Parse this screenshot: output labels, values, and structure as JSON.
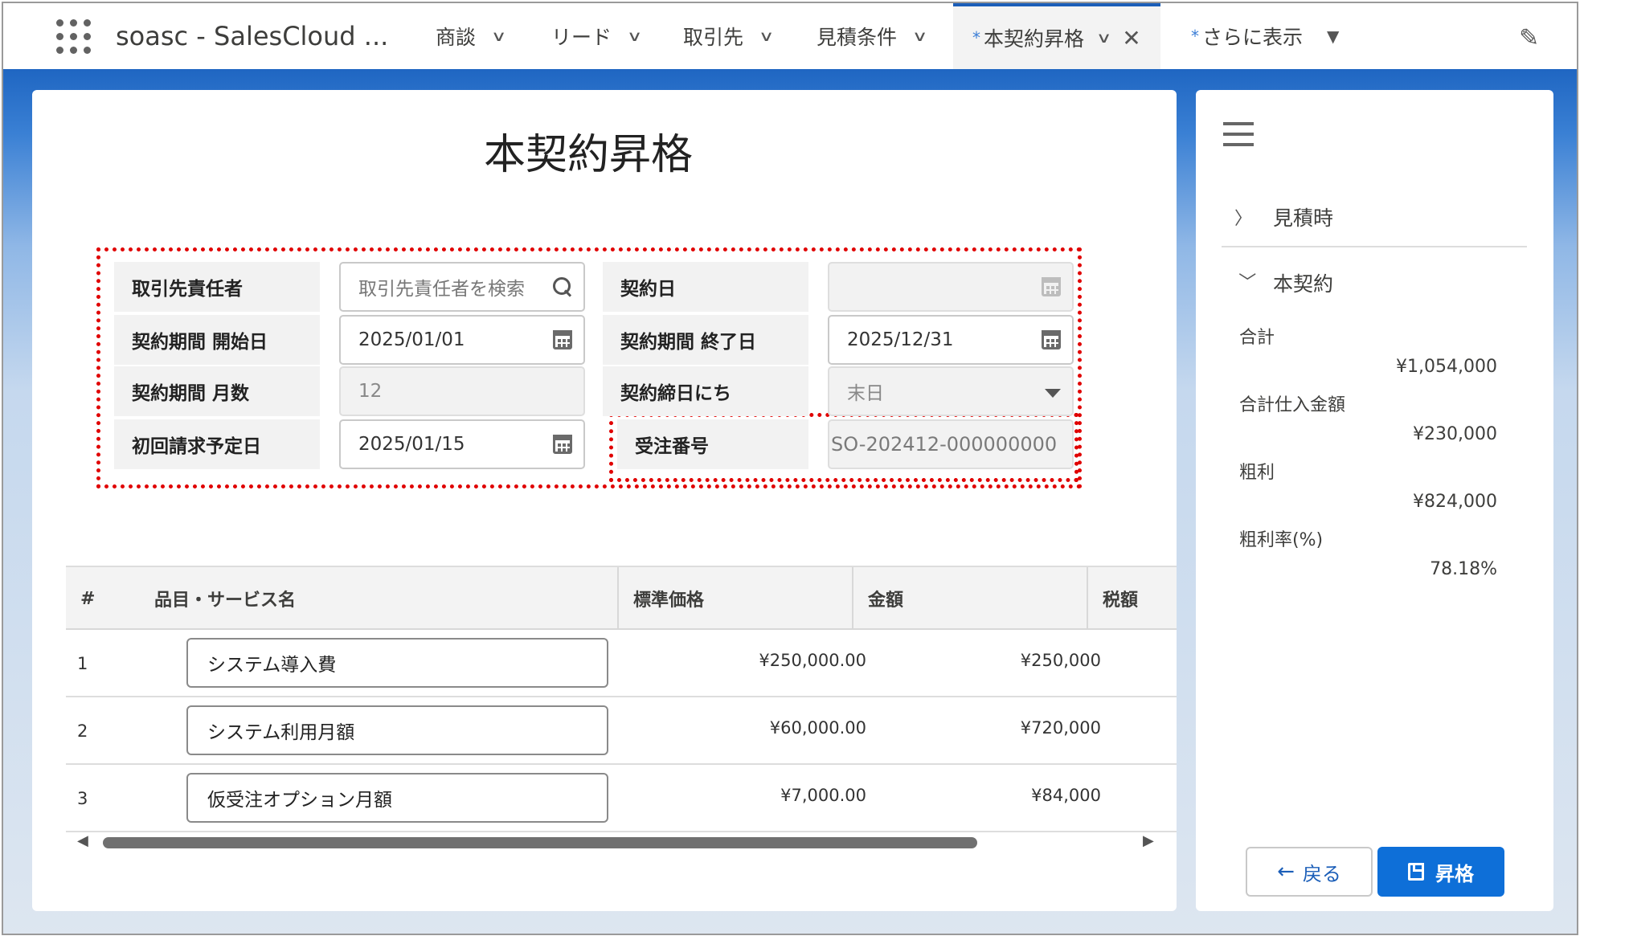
{
  "nav": {
    "app_name": "soasc - SalesCloud ...",
    "tabs": [
      {
        "label": "商談"
      },
      {
        "label": "リード"
      },
      {
        "label": "取引先"
      },
      {
        "label": "見積条件"
      },
      {
        "label": "本契約昇格",
        "modified_mark": "*",
        "active": true
      },
      {
        "label": "さらに表示",
        "modified_mark": "*"
      }
    ]
  },
  "page": {
    "title": "本契約昇格"
  },
  "form": {
    "contact_label": "取引先責任者",
    "contact_placeholder": "取引先責任者を検索",
    "contract_date_label": "契約日",
    "contract_date_value": "",
    "start_label": "契約期間 開始日",
    "start_value": "2025/01/01",
    "end_label": "契約期間 終了日",
    "end_value": "2025/12/31",
    "months_label": "契約期間 月数",
    "months_value": "12",
    "closing_label": "契約締日にち",
    "closing_value": "末日",
    "first_bill_label": "初回請求予定日",
    "first_bill_value": "2025/01/15",
    "order_no_label": "受注番号",
    "order_no_value": "SO-202412-000000000"
  },
  "table": {
    "headers": [
      "#",
      "品目・サービス名",
      "標準価格",
      "金額",
      "税額"
    ],
    "rows": [
      {
        "num": "1",
        "name": "システム導入費",
        "std_price": "¥250,000.00",
        "amount": "¥250,000"
      },
      {
        "num": "2",
        "name": "システム利用月額",
        "std_price": "¥60,000.00",
        "amount": "¥720,000"
      },
      {
        "num": "3",
        "name": "仮受注オプション月額",
        "std_price": "¥7,000.00",
        "amount": "¥84,000"
      }
    ]
  },
  "sidebar": {
    "section_quote": "見積時",
    "section_contract": "本契約",
    "items": [
      {
        "label": "合計",
        "value": "¥1,054,000"
      },
      {
        "label": "合計仕入金額",
        "value": "¥230,000"
      },
      {
        "label": "粗利",
        "value": "¥824,000"
      },
      {
        "label": "粗利率(%)",
        "value": "78.18%"
      }
    ],
    "back_label": "戻る",
    "promote_label": "昇格"
  },
  "colors": {
    "brand_blue": "#0e6fd8",
    "highlight_red": "#e00000",
    "active_tab_bar": "#1b5eb8"
  }
}
